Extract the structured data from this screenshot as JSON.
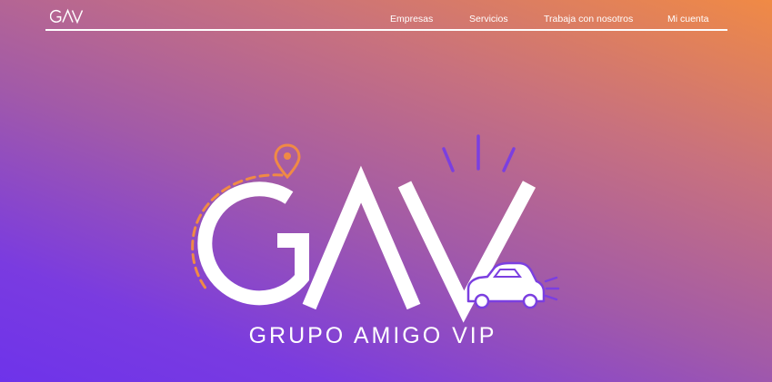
{
  "header": {
    "brand": "GAV",
    "nav": [
      {
        "label": "Empresas"
      },
      {
        "label": "Servicios"
      },
      {
        "label": "Trabaja con nosotros"
      },
      {
        "label": "Mi cuenta"
      }
    ]
  },
  "hero": {
    "logo_text": "GAV",
    "tagline": "GRUPO AMIGO VIP",
    "icons": [
      "location-pin-icon",
      "car-icon",
      "sparkle-lines-icon"
    ]
  },
  "colors": {
    "gradient_top_right": "#f08a45",
    "gradient_bottom_left": "#6e33ea",
    "accent_orange": "#f08a45",
    "accent_purple": "#7b3fe0",
    "text": "#ffffff"
  }
}
